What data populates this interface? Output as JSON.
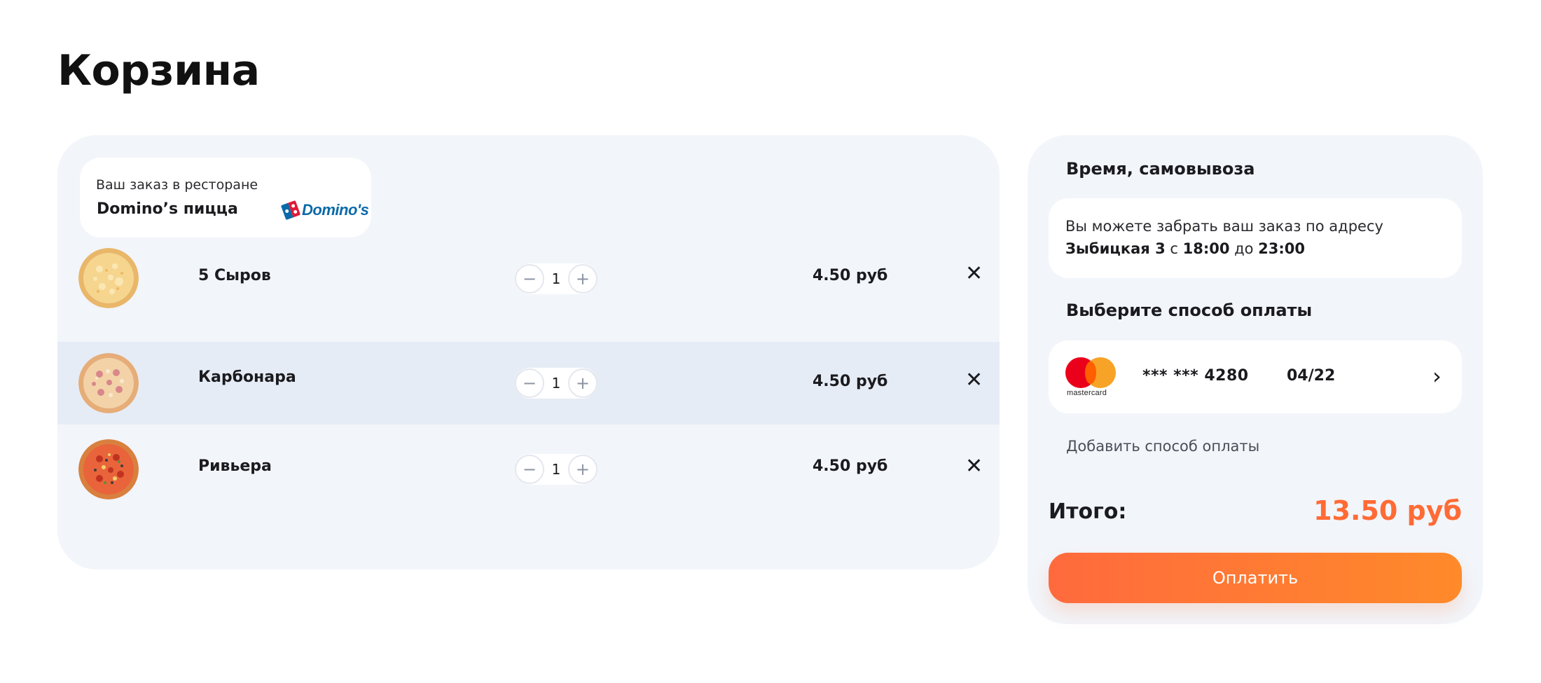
{
  "page": {
    "title": "Корзина"
  },
  "restaurant": {
    "caption": "Ваш заказ в ресторане",
    "name": "Domino’s пицца",
    "logo_text": "Domino's"
  },
  "cart": {
    "items": [
      {
        "name": "5 Сыров",
        "quantity": "1",
        "price": "4.50 руб",
        "image": "pizza-cheese-icon"
      },
      {
        "name": "Карбонара",
        "quantity": "1",
        "price": "4.50 руб",
        "image": "pizza-carbonara-icon"
      },
      {
        "name": "Ривьера",
        "quantity": "1",
        "price": "4.50 руб",
        "image": "pizza-riviera-icon"
      }
    ],
    "decrement_symbol": "−",
    "increment_symbol": "+",
    "remove_symbol": "✕"
  },
  "pickup": {
    "heading": "Время, самовывоза",
    "line1": "Вы  можете забрать ваш заказ по адресу",
    "address": "Зыбицкая 3",
    "from_word": " с ",
    "from_time": "18:00",
    "to_word": " до ",
    "to_time": "23:00"
  },
  "payment": {
    "heading": "Выберите способ оплаты",
    "card_brand": "mastercard",
    "card_number": "*** *** 4280",
    "card_expiry": "04/22",
    "chevron": "›",
    "add_method": "Добавить способ оплаты"
  },
  "summary": {
    "total_label": "Итого:",
    "total_value": "13.50 руб",
    "pay_button": "Оплатить"
  },
  "colors": {
    "accent": "#ff6b35",
    "panel_bg": "#f2f5fa",
    "row_highlight": "#e6ecf5"
  }
}
